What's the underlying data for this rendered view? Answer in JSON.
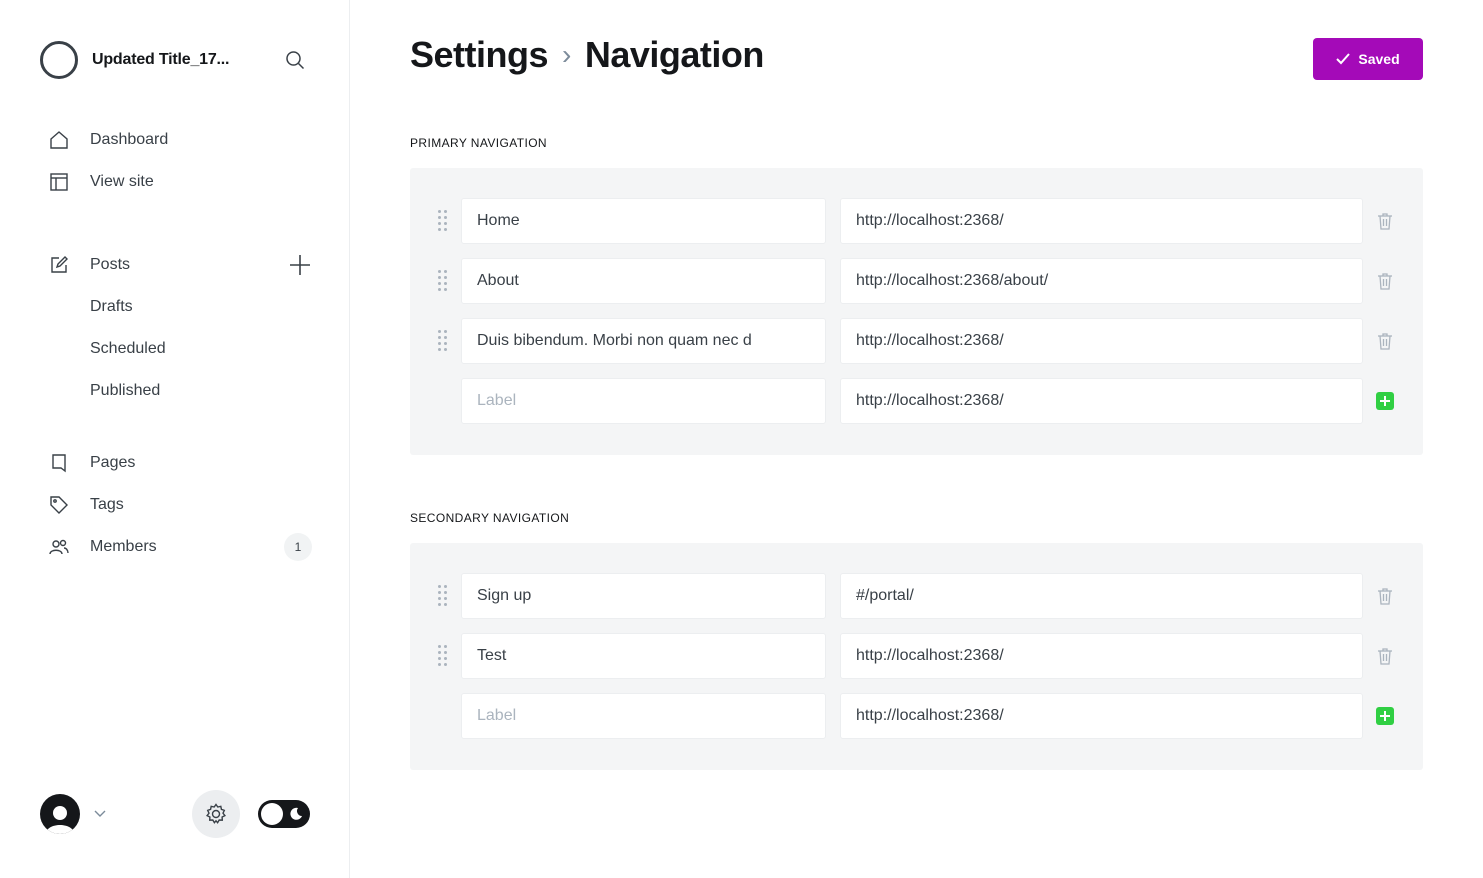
{
  "sidebar": {
    "site_title": "Updated Title_17...",
    "nav_main": [
      {
        "label": "Dashboard",
        "icon": "home-icon"
      },
      {
        "label": "View site",
        "icon": "layout-icon"
      }
    ],
    "posts": {
      "label": "Posts",
      "icon": "edit-icon"
    },
    "posts_sub": [
      {
        "label": "Drafts"
      },
      {
        "label": "Scheduled"
      },
      {
        "label": "Published"
      }
    ],
    "nav_lower": [
      {
        "label": "Pages",
        "icon": "page-icon"
      },
      {
        "label": "Tags",
        "icon": "tag-icon"
      },
      {
        "label": "Members",
        "icon": "members-icon",
        "count": "1"
      }
    ]
  },
  "header": {
    "breadcrumb_parent": "Settings",
    "breadcrumb_separator": "›",
    "breadcrumb_current": "Navigation",
    "save_label": "Saved"
  },
  "primary": {
    "title": "Primary Navigation",
    "items": [
      {
        "label": "Home",
        "url": "http://localhost:2368/"
      },
      {
        "label": "About",
        "url": "http://localhost:2368/about/"
      },
      {
        "label": "Duis bibendum. Morbi non quam nec d",
        "url": "http://localhost:2368/"
      }
    ],
    "new_item": {
      "label_placeholder": "Label",
      "url": "http://localhost:2368/"
    }
  },
  "secondary": {
    "title": "Secondary Navigation",
    "items": [
      {
        "label": "Sign up",
        "url": "#/portal/"
      },
      {
        "label": "Test",
        "url": "http://localhost:2368/"
      }
    ],
    "new_item": {
      "label_placeholder": "Label",
      "url": "http://localhost:2368/"
    }
  },
  "colors": {
    "accent": "#a40ab8",
    "add": "#30cf43",
    "panel_bg": "#f4f5f6"
  }
}
